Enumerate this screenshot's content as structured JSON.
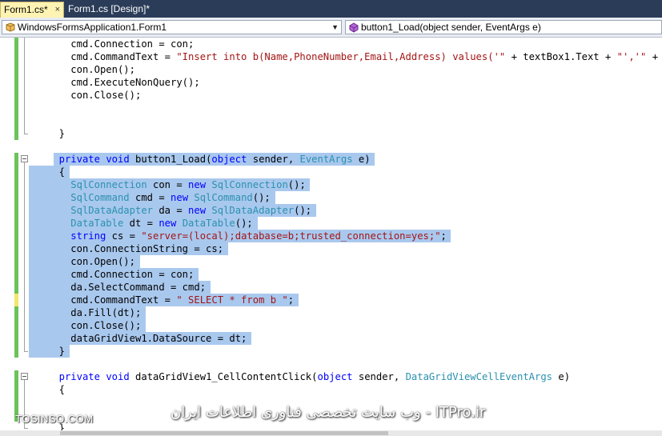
{
  "tabs": [
    {
      "label": "Form1.cs*",
      "close": "×"
    },
    {
      "label": "Form1.cs [Design]*"
    }
  ],
  "nav": {
    "class_combo": "WindowsFormsApplication1.Form1",
    "member_combo": "button1_Load(object sender, EventArgs e)"
  },
  "code_lines": [
    {
      "t": 6,
      "s": [
        [
          "p",
          "cmd.Connection = con;"
        ]
      ]
    },
    {
      "t": 6,
      "s": [
        [
          "p",
          "cmd.CommandText = "
        ],
        [
          "s",
          "\"Insert into b(Name,PhoneNumber,Email,Address) values('\""
        ],
        [
          "p",
          " + textBox1.Text + "
        ],
        [
          "s",
          "\"','\""
        ],
        [
          "p",
          " +"
        ]
      ]
    },
    {
      "t": 6,
      "s": [
        [
          "p",
          "con.Open();"
        ]
      ]
    },
    {
      "t": 6,
      "s": [
        [
          "p",
          "cmd.ExecuteNonQuery();"
        ]
      ]
    },
    {
      "t": 6,
      "s": [
        [
          "p",
          "con.Close();"
        ]
      ]
    },
    {
      "t": 0,
      "s": []
    },
    {
      "t": 0,
      "s": []
    },
    {
      "t": 4,
      "s": [
        [
          "p",
          "}"
        ]
      ]
    },
    {
      "t": 0,
      "s": []
    },
    {
      "t": 4,
      "s": [
        [
          "k",
          "private"
        ],
        [
          "p",
          " "
        ],
        [
          "k",
          "void"
        ],
        [
          "p",
          " button1_Load("
        ],
        [
          "k",
          "object"
        ],
        [
          "p",
          " sender, "
        ],
        [
          "t",
          "EventArgs"
        ],
        [
          "p",
          " e)"
        ]
      ]
    },
    {
      "t": 4,
      "s": [
        [
          "p",
          "{"
        ]
      ]
    },
    {
      "t": 6,
      "s": [
        [
          "t",
          "SqlConnection"
        ],
        [
          "p",
          " con = "
        ],
        [
          "k",
          "new"
        ],
        [
          "p",
          " "
        ],
        [
          "t",
          "SqlConnection"
        ],
        [
          "p",
          "();"
        ]
      ]
    },
    {
      "t": 6,
      "s": [
        [
          "t",
          "SqlCommand"
        ],
        [
          "p",
          " cmd = "
        ],
        [
          "k",
          "new"
        ],
        [
          "p",
          " "
        ],
        [
          "t",
          "SqlCommand"
        ],
        [
          "p",
          "();"
        ]
      ]
    },
    {
      "t": 6,
      "s": [
        [
          "t",
          "SqlDataAdapter"
        ],
        [
          "p",
          " da = "
        ],
        [
          "k",
          "new"
        ],
        [
          "p",
          " "
        ],
        [
          "t",
          "SqlDataAdapter"
        ],
        [
          "p",
          "();"
        ]
      ]
    },
    {
      "t": 6,
      "s": [
        [
          "t",
          "DataTable"
        ],
        [
          "p",
          " dt = "
        ],
        [
          "k",
          "new"
        ],
        [
          "p",
          " "
        ],
        [
          "t",
          "DataTable"
        ],
        [
          "p",
          "();"
        ]
      ]
    },
    {
      "t": 6,
      "s": [
        [
          "k",
          "string"
        ],
        [
          "p",
          " cs = "
        ],
        [
          "s",
          "\"server=(local);database=b;trusted_connection=yes;\""
        ],
        [
          "p",
          ";"
        ]
      ]
    },
    {
      "t": 6,
      "s": [
        [
          "p",
          "con.ConnectionString = cs;"
        ]
      ]
    },
    {
      "t": 6,
      "s": [
        [
          "p",
          "con.Open();"
        ]
      ]
    },
    {
      "t": 6,
      "s": [
        [
          "p",
          "cmd.Connection = con;"
        ]
      ]
    },
    {
      "t": 6,
      "s": [
        [
          "p",
          "da.SelectCommand = cmd;"
        ]
      ]
    },
    {
      "t": 6,
      "s": [
        [
          "p",
          "cmd.CommandText = "
        ],
        [
          "s",
          "\" SELECT * from b \""
        ],
        [
          "p",
          ";"
        ]
      ]
    },
    {
      "t": 6,
      "s": [
        [
          "p",
          "da.Fill(dt);"
        ]
      ]
    },
    {
      "t": 6,
      "s": [
        [
          "p",
          "con.Close();"
        ]
      ]
    },
    {
      "t": 6,
      "s": [
        [
          "p",
          "dataGridView1.DataSource = dt;"
        ]
      ]
    },
    {
      "t": 4,
      "s": [
        [
          "p",
          "}"
        ]
      ]
    },
    {
      "t": 0,
      "s": []
    },
    {
      "t": 4,
      "s": [
        [
          "k",
          "private"
        ],
        [
          "p",
          " "
        ],
        [
          "k",
          "void"
        ],
        [
          "p",
          " dataGridView1_CellContentClick("
        ],
        [
          "k",
          "object"
        ],
        [
          "p",
          " sender, "
        ],
        [
          "t",
          "DataGridViewCellEventArgs"
        ],
        [
          "p",
          " e)"
        ]
      ]
    },
    {
      "t": 4,
      "s": [
        [
          "p",
          "{"
        ]
      ]
    },
    {
      "t": 0,
      "s": []
    },
    {
      "t": 0,
      "s": []
    },
    {
      "t": 4,
      "s": [
        [
          "p",
          "}"
        ]
      ]
    }
  ],
  "watermark": {
    "left": "TOSINSO.COM",
    "right": "ITPro.ir - وب سایت تخصصی فناوری اطلاعات ایران"
  },
  "colors": {
    "keyword": "#0000ff",
    "type": "#2b91af",
    "string": "#a31515",
    "selection": "#a9c8ee",
    "change_saved": "#6cc35a",
    "change_unsaved": "#f2e66c"
  },
  "icons": [
    "class-icon",
    "method-icon",
    "dropdown-arrow-icon",
    "close-icon",
    "collapse-icon"
  ]
}
